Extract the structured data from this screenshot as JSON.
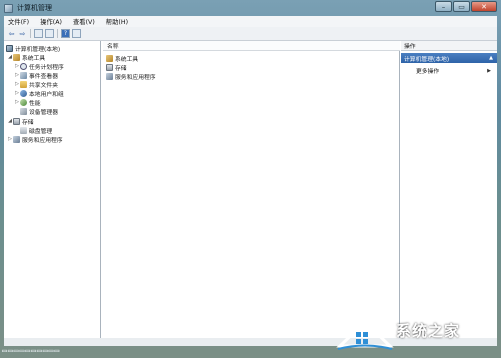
{
  "window": {
    "title": "计算机管理"
  },
  "menu": [
    "文件(F)",
    "操作(A)",
    "查看(V)",
    "帮助(H)"
  ],
  "toolbar": {
    "icons": [
      "back-arrow-icon",
      "forward-arrow-icon",
      "show-hide-tree-icon",
      "properties-icon",
      "help-icon",
      "show-hide-action-pane-icon"
    ]
  },
  "tree": {
    "root": "计算机管理(本地)",
    "system_tools": "系统工具",
    "task_scheduler": "任务计划程序",
    "event_viewer": "事件查看器",
    "shared_folders": "共享文件夹",
    "local_users": "本地用户和组",
    "performance": "性能",
    "device_manager": "设备管理器",
    "storage": "存储",
    "disk_management": "磁盘管理",
    "services": "服务和应用程序"
  },
  "content": {
    "column_name": "名称",
    "items": [
      "系统工具",
      "存储",
      "服务和应用程序"
    ]
  },
  "actions": {
    "header": "操作",
    "group": "计算机管理(本地)",
    "more": "更多操作"
  },
  "watermark": {
    "brand": "系统之家"
  }
}
